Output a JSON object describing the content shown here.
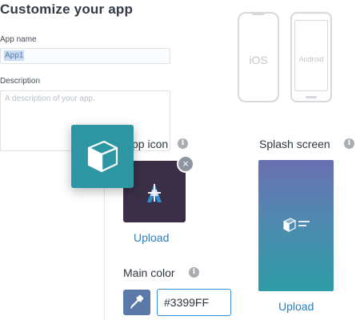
{
  "page": {
    "title": "Customize your app"
  },
  "form": {
    "app_name_label": "App name",
    "app_name_value": "App1",
    "description_label": "Description",
    "description_placeholder": "A description of your app."
  },
  "devices": {
    "ios_label": "iOS",
    "android_label": "Android"
  },
  "app_icon": {
    "title": "pp icon",
    "upload_label": "Upload",
    "close_symbol": "×"
  },
  "splash": {
    "title": "Splash screen",
    "upload_label": "Upload"
  },
  "main_color": {
    "title": "Main color",
    "value": "#3399FF"
  },
  "info_symbol": "i",
  "colors": {
    "accent": "#3399FF",
    "link": "#2b7fc0",
    "teal": "#2e96a3",
    "icon_bg": "#3a2f47",
    "eyedropper_bg": "#5b79a8"
  }
}
